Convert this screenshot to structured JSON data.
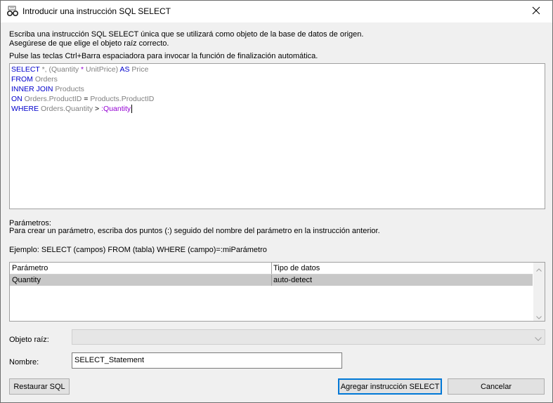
{
  "window": {
    "title": "Introducir una instrucción SQL SELECT"
  },
  "intro": {
    "line1": "Escriba una instrucción SQL SELECT única que se utilizará como objeto de la base de datos de origen.",
    "line2": "Asegúrese de que elige el objeto raíz correcto.",
    "hint": "Pulse las teclas Ctrl+Barra espaciadora para invocar la función de finalización automática."
  },
  "sql": {
    "l1": {
      "kw1": "SELECT",
      "rest1": " *, (Quantity ",
      "op": "*",
      "rest2": " UnitPrice) ",
      "kw2": "AS",
      "rest3": " Price"
    },
    "l2": {
      "kw": "FROM",
      "rest": " Orders"
    },
    "l3": {
      "kw": "INNER JOIN",
      "rest": " Products"
    },
    "l4": {
      "kw": "ON",
      "rest1": " Orders.ProductID ",
      "op": "=",
      "rest2": " Products.ProductID"
    },
    "l5": {
      "kw": "WHERE",
      "rest": " Orders.Quantity ",
      "op": ">",
      "param": " :Quantity"
    }
  },
  "params": {
    "heading": "Parámetros:",
    "description": "Para crear un parámetro, escriba dos puntos (:) seguido del nombre del parámetro en la instrucción anterior.",
    "example": "Ejemplo: SELECT (campos) FROM (tabla) WHERE (campo)=:miParámetro",
    "columns": [
      "Parámetro",
      "Tipo de datos"
    ],
    "rows": [
      {
        "name": "Quantity",
        "type": "auto-detect"
      }
    ]
  },
  "root_object": {
    "label": "Objeto raíz:",
    "value": ""
  },
  "name_field": {
    "label": "Nombre:",
    "value": "SELECT_Statement"
  },
  "buttons": {
    "restore": "Restaurar SQL",
    "add": "Agregar instrucción SELECT",
    "cancel": "Cancelar"
  },
  "icons": {
    "app": "sql-glasses-icon",
    "close": "close-icon"
  }
}
